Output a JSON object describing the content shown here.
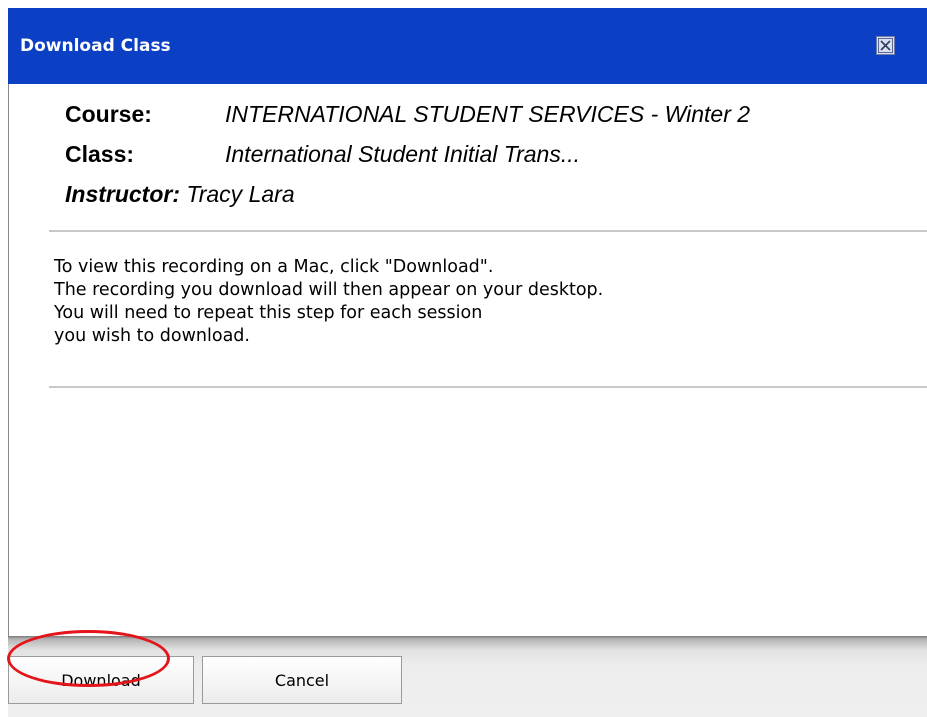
{
  "dialog": {
    "title": "Download Class",
    "close_icon": "close-x-icon"
  },
  "info": {
    "course_label": "Course:",
    "course_value": "INTERNATIONAL STUDENT SERVICES - Winter 2",
    "class_label": "Class:",
    "class_value": "International Student Initial Trans...",
    "instructor_label": "Instructor:",
    "instructor_value": "Tracy Lara"
  },
  "message": {
    "lines": [
      "To view this recording on a Mac, click \"Download\".",
      "The recording you download will then appear on your desktop.",
      "You will need to repeat this step for each session",
      "you wish to download."
    ]
  },
  "footer": {
    "download_label": "Download",
    "cancel_label": "Cancel"
  },
  "colors": {
    "title_bar": "#0b3fc4",
    "annotation_ring": "#e4141a"
  }
}
